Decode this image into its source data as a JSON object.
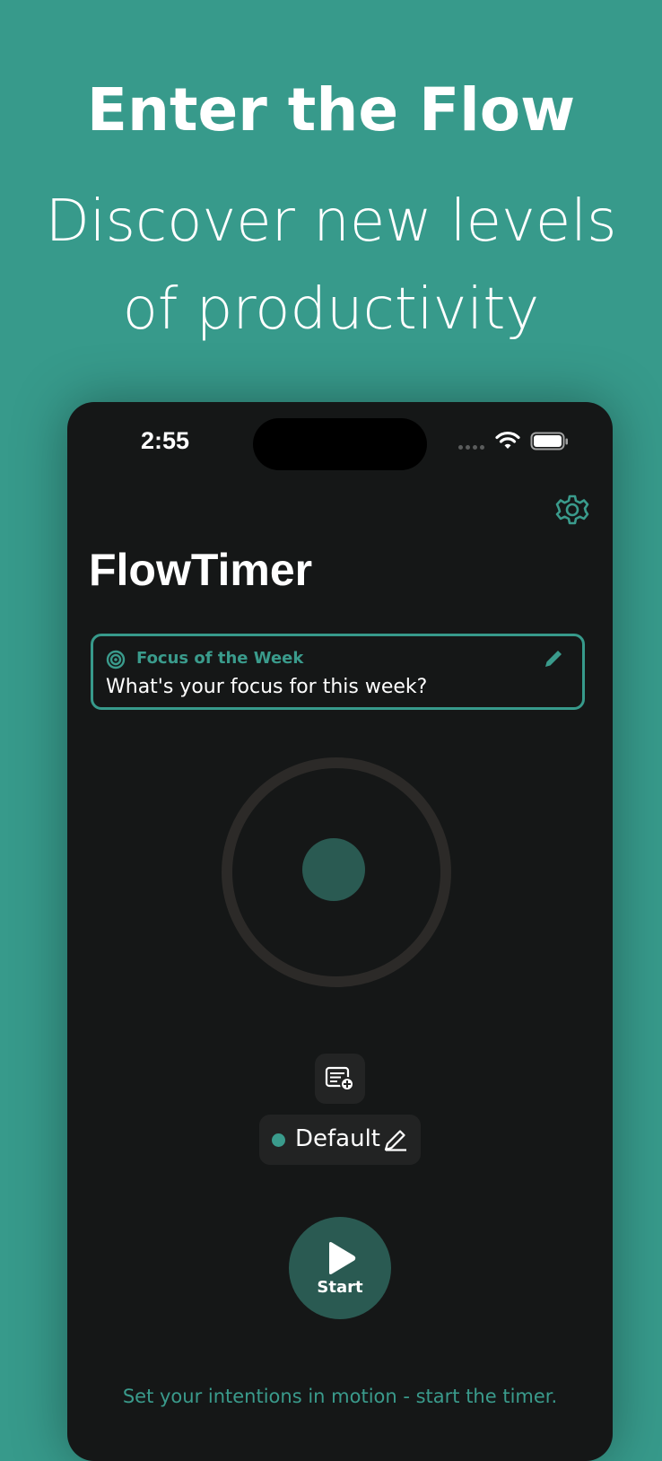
{
  "marketing": {
    "headline": "Enter the Flow",
    "subline_1": "Discover new levels",
    "subline_2": "of productivity"
  },
  "status_bar": {
    "time": "2:55",
    "icons": [
      "signal-dots-icon",
      "wifi-icon",
      "battery-icon"
    ]
  },
  "header": {
    "settings_icon": "gear-icon"
  },
  "app": {
    "title": "FlowTimer"
  },
  "focus_card": {
    "label": "Focus of the Week",
    "placeholder": "What's your focus for this week?",
    "icon": "target-icon",
    "edit_icon": "pencil-icon"
  },
  "timer": {
    "ring_color": "#2c2a28",
    "core_color": "#2a5a52"
  },
  "controls": {
    "add_note_icon": "note-add-icon",
    "profile_label": "Default",
    "profile_dot_color": "#3a9b8c",
    "profile_edit_icon": "edit-icon",
    "start_label": "Start",
    "start_icon": "play-icon"
  },
  "hint": {
    "text": "Set your intentions in motion - start the timer."
  },
  "colors": {
    "background": "#379a8b",
    "phone": "#151717",
    "accent": "#3a9b8c"
  }
}
